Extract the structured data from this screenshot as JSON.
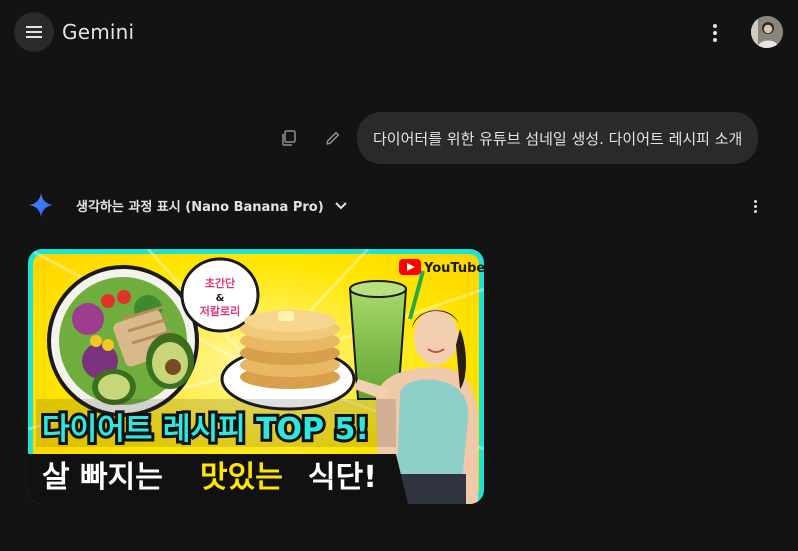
{
  "header": {
    "menu_icon": "hamburger-menu-icon",
    "title": "Gemini",
    "more_icon": "more-vert-icon",
    "avatar_icon": "user-avatar"
  },
  "user_message": {
    "text": "다이어터를 위한 유튜브 섬네일 생성. 다이어트 레시피 소개",
    "copy_icon": "copy-icon",
    "edit_icon": "edit-pencil-icon"
  },
  "response": {
    "spark_icon": "gemini-spark-icon",
    "thinking_label": "생각하는 과정 표시 (Nano Banana Pro)",
    "expand_icon": "chevron-down-icon",
    "more_icon": "more-vert-icon"
  },
  "thumbnail": {
    "badge_line1": "초간단",
    "badge_amp": "&",
    "badge_line2": "저칼로리",
    "youtube_label": "YouTube",
    "headline_line1": "다이어트 레시피 TOP 5!",
    "headline_line2_a": "살 빠지는",
    "headline_line2_b": "맛있는",
    "headline_line2_c": "식단!",
    "colors": {
      "frame": "#1ee3d2",
      "background": "#ffe600",
      "headline_cyan": "#2ee8e0",
      "headline_yellow": "#ffe600",
      "stroke": "#111111",
      "youtube_red": "#ff0000"
    }
  },
  "colors": {
    "page_bg": "#131314",
    "bubble_bg": "#2a2a2c",
    "text": "#e3e3e3",
    "icon_muted": "#8e918f"
  }
}
